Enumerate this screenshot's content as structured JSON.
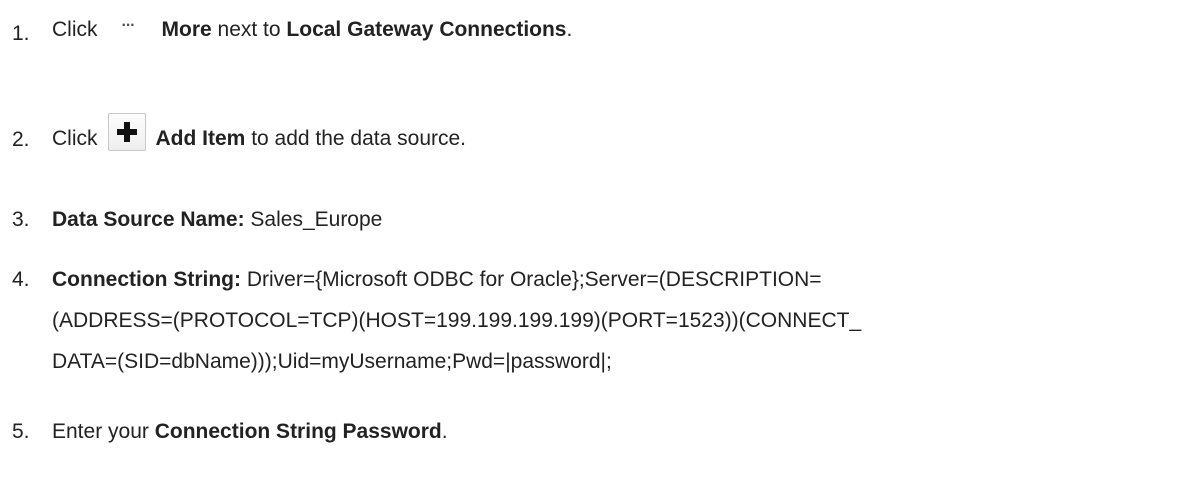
{
  "steps": [
    {
      "number": "1.",
      "prefix": "Click",
      "icon": "more-ellipsis-icon",
      "bold_label": "More",
      "middle": "next to",
      "bold_target": "Local Gateway Connections",
      "suffix": "."
    },
    {
      "number": "2.",
      "prefix": "Click",
      "icon": "plus-icon",
      "bold_label": "Add Item",
      "suffix": "to add the data source."
    },
    {
      "number": "3.",
      "bold_label": "Data Source Name:",
      "value": "Sales_Europe"
    },
    {
      "number": "4.",
      "bold_label": "Connection String:",
      "lines": [
        "Driver={Microsoft ODBC for Oracle};Server=(DESCRIPTION=",
        "(ADDRESS=(PROTOCOL=TCP)(HOST=199.199.199.199)(PORT=1523))(CONNECT_",
        "DATA=(SID=dbName)));Uid=myUsername;Pwd=|password|;"
      ]
    },
    {
      "number": "5.",
      "prefix": "Enter your",
      "bold_label": "Connection String Password",
      "suffix": "."
    }
  ]
}
